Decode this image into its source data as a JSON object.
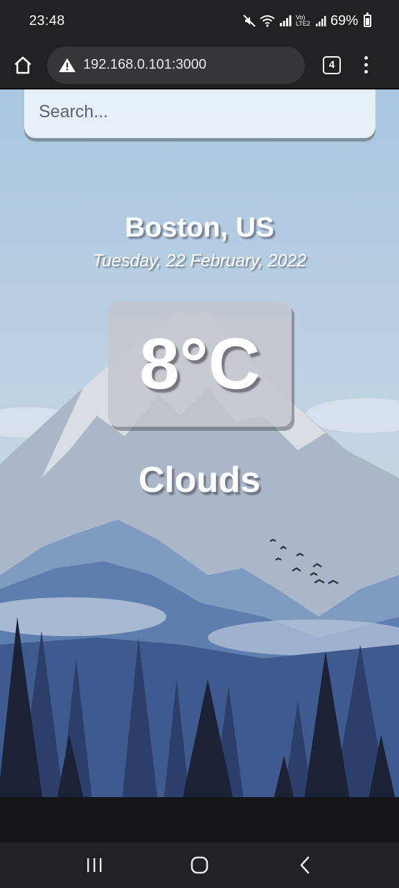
{
  "status_bar": {
    "time": "23:48",
    "battery": "69%",
    "network_label": "Vo) LTE2",
    "icons": [
      "mute-icon",
      "wifi-icon",
      "signal-icon",
      "battery-icon"
    ]
  },
  "browser": {
    "url": "192.168.0.101:3000",
    "tab_count": "4",
    "icons": [
      "home-icon",
      "warning-icon",
      "tabs-icon",
      "menu-icon"
    ]
  },
  "weather_app": {
    "search": {
      "placeholder": "Search..."
    },
    "location": "Boston, US",
    "date": "Tuesday, 22 February, 2022",
    "temperature": "8°C",
    "condition": "Clouds"
  },
  "nav_bar": {
    "icons": [
      "recent-apps-icon",
      "home-icon",
      "back-icon"
    ]
  }
}
